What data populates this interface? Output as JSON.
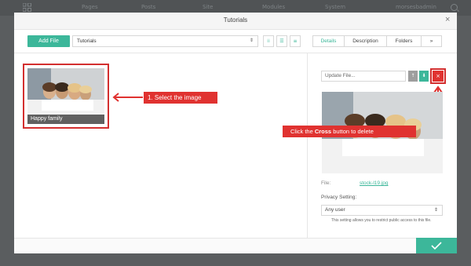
{
  "nav": {
    "items": [
      "Pages",
      "Posts",
      "Site",
      "Modules",
      "System",
      "morsesbadmin"
    ]
  },
  "modal": {
    "title": "Tutorials",
    "close_symbol": "×"
  },
  "toolbar": {
    "add_file_label": "Add File",
    "folder_value": "Tutorials",
    "select_caret": "⇕",
    "view_icons": [
      "thumbnails-view-icon",
      "list-view-icon",
      "detail-view-icon"
    ]
  },
  "tabs": [
    "Details",
    "Description",
    "Folders",
    "»"
  ],
  "image_item": {
    "caption": "Happy family"
  },
  "callouts": {
    "select": "1. Select the image",
    "delete_prefix": "Click the ",
    "delete_bold": "Cross",
    "delete_suffix": " button to delete"
  },
  "details": {
    "update_placeholder": "Update File...",
    "btn_refresh": "↑",
    "btn_download": "⬇",
    "btn_delete": "×",
    "file_label": "File:",
    "file_name": "stock-l19.jpg",
    "privacy_label": "Privacy Setting:",
    "privacy_value": "Any user",
    "privacy_help": "This setting allows you to restrict public access to this file."
  },
  "footer": {
    "confirm_icon": "checkmark-icon"
  },
  "colors": {
    "accent": "#3cb79a",
    "annotation_red": "#e03230"
  }
}
